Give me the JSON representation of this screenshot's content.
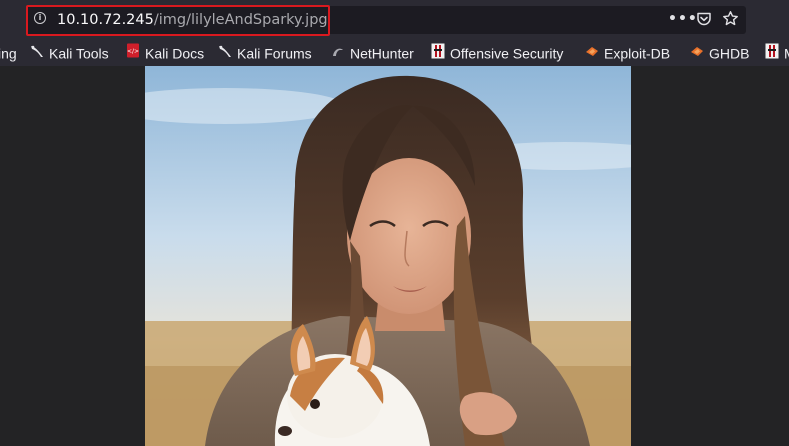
{
  "address_bar": {
    "host": "10.10.72.245",
    "path": "/img/lilyleAndSparky.jpg"
  },
  "page_actions": {
    "more_label": "•••"
  },
  "bookmarks": [
    {
      "label": "ing",
      "icon": "bookmark-icon"
    },
    {
      "label": "Kali Tools",
      "icon": "kali-dragon-icon"
    },
    {
      "label": "Kali Docs",
      "icon": "kali-docs-icon"
    },
    {
      "label": "Kali Forums",
      "icon": "kali-dragon-icon"
    },
    {
      "label": "NetHunter",
      "icon": "nethunter-icon"
    },
    {
      "label": "Offensive Security",
      "icon": "offsec-icon"
    },
    {
      "label": "Exploit-DB",
      "icon": "exploitdb-icon"
    },
    {
      "label": "GHDB",
      "icon": "ghdb-icon"
    },
    {
      "label": "M",
      "icon": "offsec-icon"
    }
  ],
  "colors": {
    "chrome": "#2b2a33",
    "page_background": "#232325",
    "highlight_border": "#d9191f"
  },
  "image": {
    "content": "photo of a woman with long brown hair holding a white and tan chihuahua"
  }
}
